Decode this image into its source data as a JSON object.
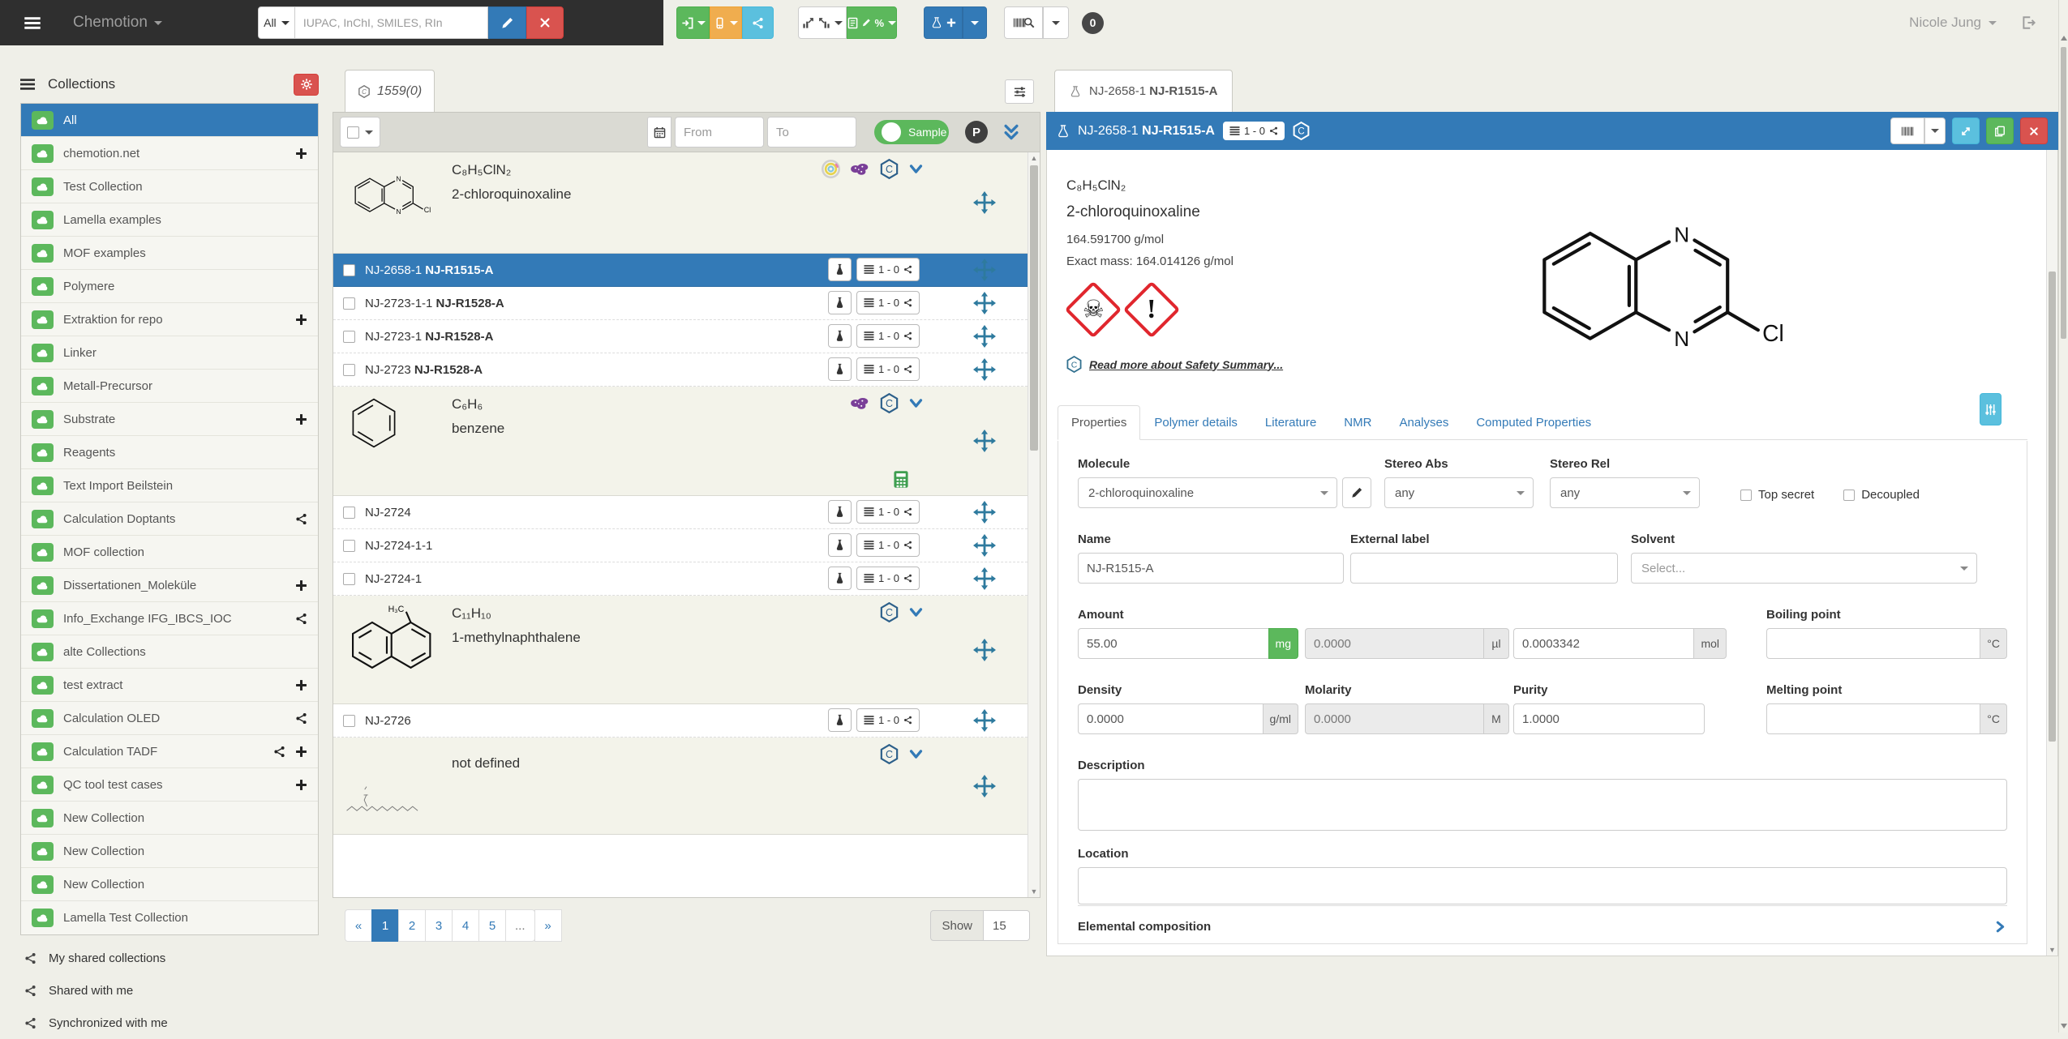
{
  "colors": {
    "primary": "#337ab7",
    "success": "#5cb85c",
    "warning": "#f0ad4e",
    "info": "#5bc0de",
    "danger": "#d9534f",
    "navbar": "#2f2f2f",
    "ghs_red": "#e0262d"
  },
  "navbar": {
    "brand": "Chemotion",
    "search_scope": "All",
    "search_placeholder": "IUPAC, InChI, SMILES, RIn",
    "percent_glyph": "%",
    "queue_count": "0",
    "user": "Nicole Jung"
  },
  "sidebar": {
    "title": "Collections",
    "items": [
      {
        "label": "All",
        "selected": true
      },
      {
        "label": "chemotion.net",
        "icon": "cloud",
        "actions": [
          "plus"
        ]
      },
      {
        "label": "Test Collection"
      },
      {
        "label": "Lamella examples"
      },
      {
        "label": "MOF examples"
      },
      {
        "label": "Polymere"
      },
      {
        "label": "Extraktion for repo",
        "actions": [
          "plus"
        ]
      },
      {
        "label": "Linker"
      },
      {
        "label": "Metall-Precursor"
      },
      {
        "label": "Substrate",
        "actions": [
          "plus"
        ]
      },
      {
        "label": "Reagents"
      },
      {
        "label": "Text Import Beilstein"
      },
      {
        "label": "Calculation Doptants",
        "actions": [
          "share"
        ]
      },
      {
        "label": "MOF collection"
      },
      {
        "label": "Dissertationen_Moleküle",
        "actions": [
          "plus"
        ]
      },
      {
        "label": "Info_Exchange IFG_IBCS_IOC",
        "actions": [
          "share"
        ]
      },
      {
        "label": "alte Collections"
      },
      {
        "label": "test extract",
        "actions": [
          "plus"
        ]
      },
      {
        "label": "Calculation OLED",
        "actions": [
          "share"
        ]
      },
      {
        "label": "Calculation TADF",
        "actions": [
          "share",
          "plus"
        ]
      },
      {
        "label": "QC tool test cases",
        "actions": [
          "plus"
        ]
      },
      {
        "label": "New Collection"
      },
      {
        "label": "New Collection"
      },
      {
        "label": "New Collection"
      },
      {
        "label": "Lamella Test Collection"
      }
    ],
    "footer_links": [
      {
        "label": "My shared collections"
      },
      {
        "label": "Shared with me"
      },
      {
        "label": "Synchronized with me"
      }
    ]
  },
  "list_panel": {
    "tab_label": "1559(0)",
    "filter": {
      "from_placeholder": "From",
      "to_placeholder": "To",
      "toggle_label": "Sample",
      "badge": "P"
    },
    "groups": [
      {
        "formula": "C₈H₅ClN₂",
        "name": "2-chloroquinoxaline",
        "structure": "quinoxaline",
        "icons": [
          "rings",
          "molecule-cluster",
          "hexagon",
          "chevron-down"
        ],
        "calculator": false,
        "rows": [
          {
            "id": "NJ-2658-1",
            "name": "NJ-R1515-A",
            "badge": "1 - 0",
            "selected": true,
            "vial": false
          },
          {
            "id": "NJ-2723-1-1",
            "name": "NJ-R1528-A",
            "badge": "1 - 0",
            "selected": false,
            "vial": false
          },
          {
            "id": "NJ-2723-1",
            "name": "NJ-R1528-A",
            "badge": "1 - 0",
            "selected": false,
            "vial": false
          },
          {
            "id": "NJ-2723",
            "name": "NJ-R1528-A",
            "badge": "1 - 0",
            "selected": false,
            "vial": true
          }
        ]
      },
      {
        "formula": "C₆H₆",
        "name": "benzene",
        "structure": "benzene",
        "icons": [
          "molecule-cluster",
          "hexagon",
          "chevron-down"
        ],
        "calculator": true,
        "rows": [
          {
            "id": "NJ-2724",
            "name": "",
            "badge": "1 - 0",
            "selected": false,
            "vial": false
          },
          {
            "id": "NJ-2724-1-1",
            "name": "",
            "badge": "1 - 0",
            "selected": false,
            "vial": false
          },
          {
            "id": "NJ-2724-1",
            "name": "",
            "badge": "1 - 0",
            "selected": false,
            "vial": false
          }
        ]
      },
      {
        "formula": "C₁₁H₁₀",
        "name": "1-methylnaphthalene",
        "structure": "methylnaphthalene",
        "icons": [
          "hexagon",
          "chevron-down"
        ],
        "calculator": false,
        "rows": [
          {
            "id": "NJ-2726",
            "name": "",
            "badge": "1 - 0",
            "selected": false,
            "vial": false
          }
        ]
      },
      {
        "formula": "",
        "name": "not defined",
        "structure": "squiggle",
        "icons": [
          "hexagon",
          "chevron-down"
        ],
        "calculator": false,
        "rows": []
      }
    ],
    "pagination": {
      "items": [
        {
          "label": "«"
        },
        {
          "label": "1",
          "active": true
        },
        {
          "label": "2"
        },
        {
          "label": "3"
        },
        {
          "label": "4"
        },
        {
          "label": "5"
        },
        {
          "label": "...",
          "dots": true
        },
        {
          "label": "»"
        }
      ],
      "show_label": "Show",
      "page_size": "15"
    }
  },
  "detail_panel": {
    "tab": {
      "prefix": "NJ-2658-1",
      "bold": "NJ-R1515-A"
    },
    "header": {
      "prefix": "NJ-2658-1",
      "bold": "NJ-R1515-A",
      "badge": "1 - 0"
    },
    "molecule": {
      "formula": "C₈H₅ClN₂",
      "name": "2-chloroquinoxaline",
      "molecular_weight": "164.591700 g/mol",
      "exact_mass": "Exact mass: 164.014126 g/mol",
      "safety_link": "Read more about Safety Summary..."
    },
    "structure_atoms": {
      "n1": "N",
      "n2": "N",
      "cl": "Cl"
    },
    "thumb_atom_labels": {
      "methyl": "H₃C"
    },
    "tabs": [
      {
        "label": "Properties",
        "active": true
      },
      {
        "label": "Polymer details"
      },
      {
        "label": "Literature"
      },
      {
        "label": "NMR"
      },
      {
        "label": "Analyses"
      },
      {
        "label": "Computed Properties"
      }
    ],
    "form": {
      "molecule_label": "Molecule",
      "molecule_value": "2-chloroquinoxaline",
      "stereo_abs_label": "Stereo Abs",
      "stereo_abs_value": "any",
      "stereo_rel_label": "Stereo Rel",
      "stereo_rel_value": "any",
      "top_secret_label": "Top secret",
      "decoupled_label": "Decoupled",
      "name_label": "Name",
      "name_value": "NJ-R1515-A",
      "external_label": "External label",
      "external_value": "",
      "solvent_label": "Solvent",
      "solvent_placeholder": "Select...",
      "amount_label": "Amount",
      "amount_g": {
        "value": "55.00",
        "unit": "mg"
      },
      "amount_l": {
        "value": "0.0000",
        "unit": "µl"
      },
      "amount_mol": {
        "value": "0.0003342",
        "unit": "mol"
      },
      "boiling_label": "Boiling point",
      "boiling_value": "",
      "boiling_unit": "°C",
      "density_label": "Density",
      "density": {
        "value": "0.0000",
        "unit": "g/ml"
      },
      "molarity_label": "Molarity",
      "molarity": {
        "value": "0.0000",
        "unit": "M"
      },
      "purity_label": "Purity",
      "purity_value": "1.0000",
      "melting_label": "Melting point",
      "melting_value": "",
      "melting_unit": "°C",
      "description_label": "Description",
      "description_value": "",
      "location_label": "Location",
      "location_value": "",
      "elemental_label": "Elemental composition"
    }
  }
}
